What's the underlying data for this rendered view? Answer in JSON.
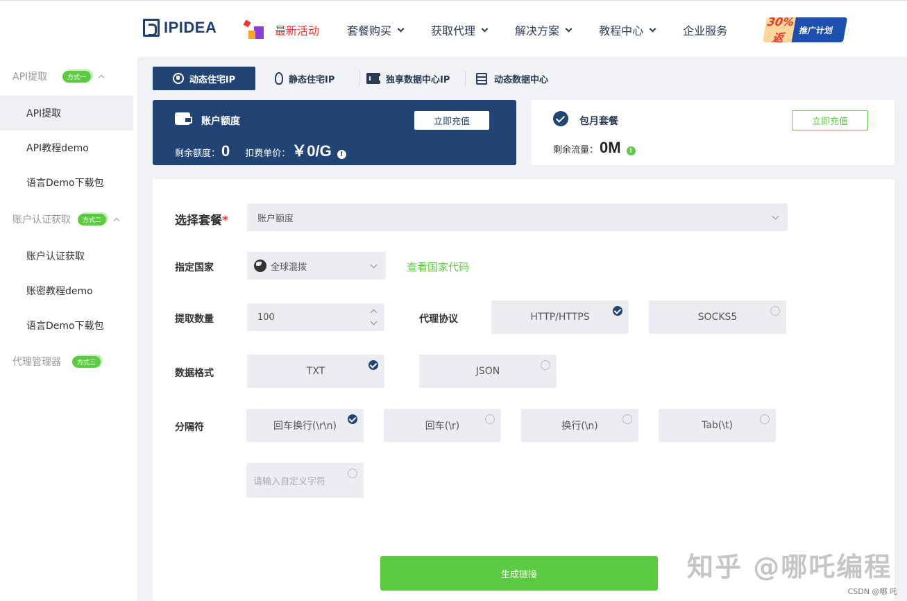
{
  "header": {
    "brand": "IPIDEA",
    "nav": [
      {
        "label": "最新活动",
        "hot": true
      },
      {
        "label": "套餐购买",
        "dropdown": true
      },
      {
        "label": "获取代理",
        "dropdown": true
      },
      {
        "label": "解决方案",
        "dropdown": true
      },
      {
        "label": "教程中心",
        "dropdown": true
      },
      {
        "label": "企业服务",
        "dropdown": false
      }
    ],
    "promo": {
      "number": "30%返",
      "label": "推广计划"
    }
  },
  "sidebar": {
    "groups": [
      {
        "label": "API提取",
        "badge": "方式一",
        "items": [
          "API提取",
          "API教程demo",
          "语言Demo下载包"
        ]
      },
      {
        "label": "账户认证获取",
        "badge": "方式二",
        "items": [
          "账户认证获取",
          "账密教程demo",
          "语言Demo下载包"
        ]
      },
      {
        "label": "代理管理器",
        "badge": "方式三",
        "items": []
      }
    ],
    "active": "API提取"
  },
  "product_tabs": [
    "动态住宅IP",
    "静态住宅IP",
    "独享数据中心IP",
    "动态数据中心"
  ],
  "balance": {
    "title": "账户额度",
    "remaining_label": "剩余额度：",
    "remaining_value": "0",
    "price_label": "扣费单价：",
    "price_value": "￥0/G",
    "recharge": "立即充值"
  },
  "monthly": {
    "title": "包月套餐",
    "traffic_label": "剩余流量：",
    "traffic_value": "0M",
    "recharge": "立即充值"
  },
  "form": {
    "package_label": "选择套餐",
    "package_value": "账户额度",
    "country_label": "指定国家",
    "country_value": "全球混拨",
    "country_link": "查看国家代码",
    "quantity_label": "提取数量",
    "quantity_value": "100",
    "protocol_label": "代理协议",
    "protocols": [
      {
        "label": "HTTP/HTTPS",
        "selected": true
      },
      {
        "label": "SOCKS5",
        "selected": false
      }
    ],
    "format_label": "数据格式",
    "formats": [
      {
        "label": "TXT",
        "selected": true
      },
      {
        "label": "JSON",
        "selected": false
      }
    ],
    "separator_label": "分隔符",
    "separators": [
      {
        "label": "回车换行(\\r\\n)",
        "selected": true
      },
      {
        "label": "回车(\\r)",
        "selected": false
      },
      {
        "label": "换行(\\n)",
        "selected": false
      },
      {
        "label": "Tab(\\t)",
        "selected": false
      }
    ],
    "custom_placeholder": "请输入自定义字符",
    "generate": "生成链接"
  },
  "watermark": "知乎 @哪吒编程",
  "credit": "CSDN @哪 吒",
  "colors": {
    "primary": "#214475",
    "accent": "#5ccb42",
    "hot": "#e8382f"
  }
}
